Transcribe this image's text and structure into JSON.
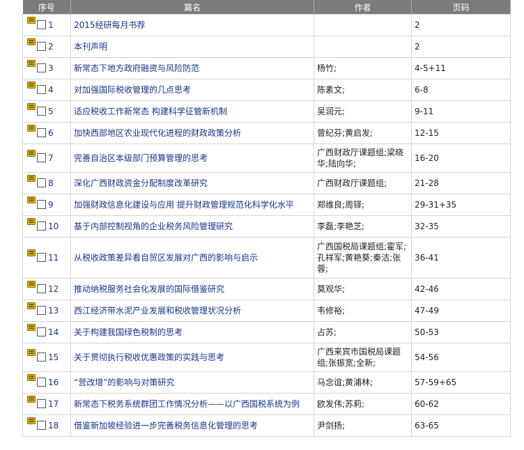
{
  "headers": {
    "no": "序号",
    "title": "篇名",
    "author": "作者",
    "pages": "页码"
  },
  "rows": [
    {
      "no": "1",
      "title": "2015经研每月书荐",
      "author": "",
      "pages": "2"
    },
    {
      "no": "2",
      "title": "本刊声明",
      "author": "",
      "pages": "2"
    },
    {
      "no": "3",
      "title": "新常态下地方政府融资与风险防范",
      "author": "杨竹;",
      "pages": "4-5+11"
    },
    {
      "no": "4",
      "title": "对加强国际税收管理的几点思考",
      "author": "陈素文;",
      "pages": "6-8"
    },
    {
      "no": "5",
      "title": "适应税收工作新常态 构建科学征管新机制",
      "author": "吴润元;",
      "pages": "9-11"
    },
    {
      "no": "6",
      "title": "加快西部地区农业现代化进程的财政政策分析",
      "author": "曾纪芬;黄启发;",
      "pages": "12-15"
    },
    {
      "no": "7",
      "title": "完善自治区本级部门预算管理的思考",
      "author": "广西财政厅课题组;梁晓华;陆向华;",
      "pages": "16-20"
    },
    {
      "no": "8",
      "title": "深化广西财政资金分配制度改革研究",
      "author": "广西财政厅课题组;",
      "pages": "21-28"
    },
    {
      "no": "9",
      "title": "加强财政信息化建设与应用 提升财政管理规范化科学化水平",
      "author": "郑维良;周铎;",
      "pages": "29-31+35"
    },
    {
      "no": "10",
      "title": "基于内部控制视角的企业税务风险管理研究",
      "author": "李磊;李艳芝;",
      "pages": "32-35"
    },
    {
      "no": "11",
      "title": "从税收政策差异看自贸区发展对广西的影响与启示",
      "author": "广西国税局课题组;霍军;孔祥军;黄艳葵;秦洁;张蓉;",
      "pages": "36-41"
    },
    {
      "no": "12",
      "title": "推动纳税服务社会化发展的国际借鉴研究",
      "author": "莫观华;",
      "pages": "42-46"
    },
    {
      "no": "13",
      "title": "西江经济带水泥产业发展和税收管理状况分析",
      "author": "韦修裕;",
      "pages": "47-49"
    },
    {
      "no": "14",
      "title": "关于构建我国绿色税制的思考",
      "author": "占苏;",
      "pages": "50-53"
    },
    {
      "no": "15",
      "title": "关于贯彻执行税收优惠政策的实践与思考",
      "author": "广西来宾市国税局课题组;张振宽;全新;",
      "pages": "54-56"
    },
    {
      "no": "16",
      "title": "“营改增”的影响与对策研究",
      "author": "马念谊;黄浦林;",
      "pages": "57-59+65"
    },
    {
      "no": "17",
      "title": "新常态下税务系统群团工作情况分析——以广西国税系统为例",
      "author": "欧发伟;苏莉;",
      "pages": "60-62"
    },
    {
      "no": "18",
      "title": "借鉴新加坡经验进一步完善税务信息化管理的思考",
      "author": "尹剑扬;",
      "pages": "63-65"
    }
  ]
}
